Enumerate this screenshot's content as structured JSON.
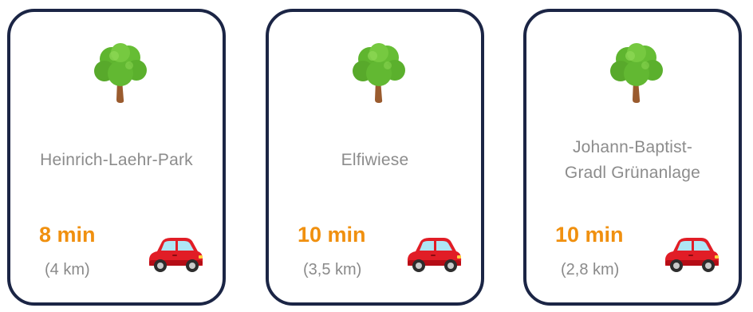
{
  "cards": [
    {
      "name": "Heinrich-Laehr-Park",
      "time": "8 min",
      "distance": "(4 km)"
    },
    {
      "name": "Elfiwiese",
      "time": "10 min",
      "distance": "(3,5 km)"
    },
    {
      "name_line1": "Johann-Baptist-",
      "name_line2": "Gradl Grünanlage",
      "time": "10 min",
      "distance": "(2,8 km)"
    }
  ],
  "icons": {
    "tree": "tree-icon",
    "car": "car-icon"
  },
  "colors": {
    "border": "#1b2545",
    "time": "#f0900f",
    "muted_text": "#8c8c8c"
  }
}
